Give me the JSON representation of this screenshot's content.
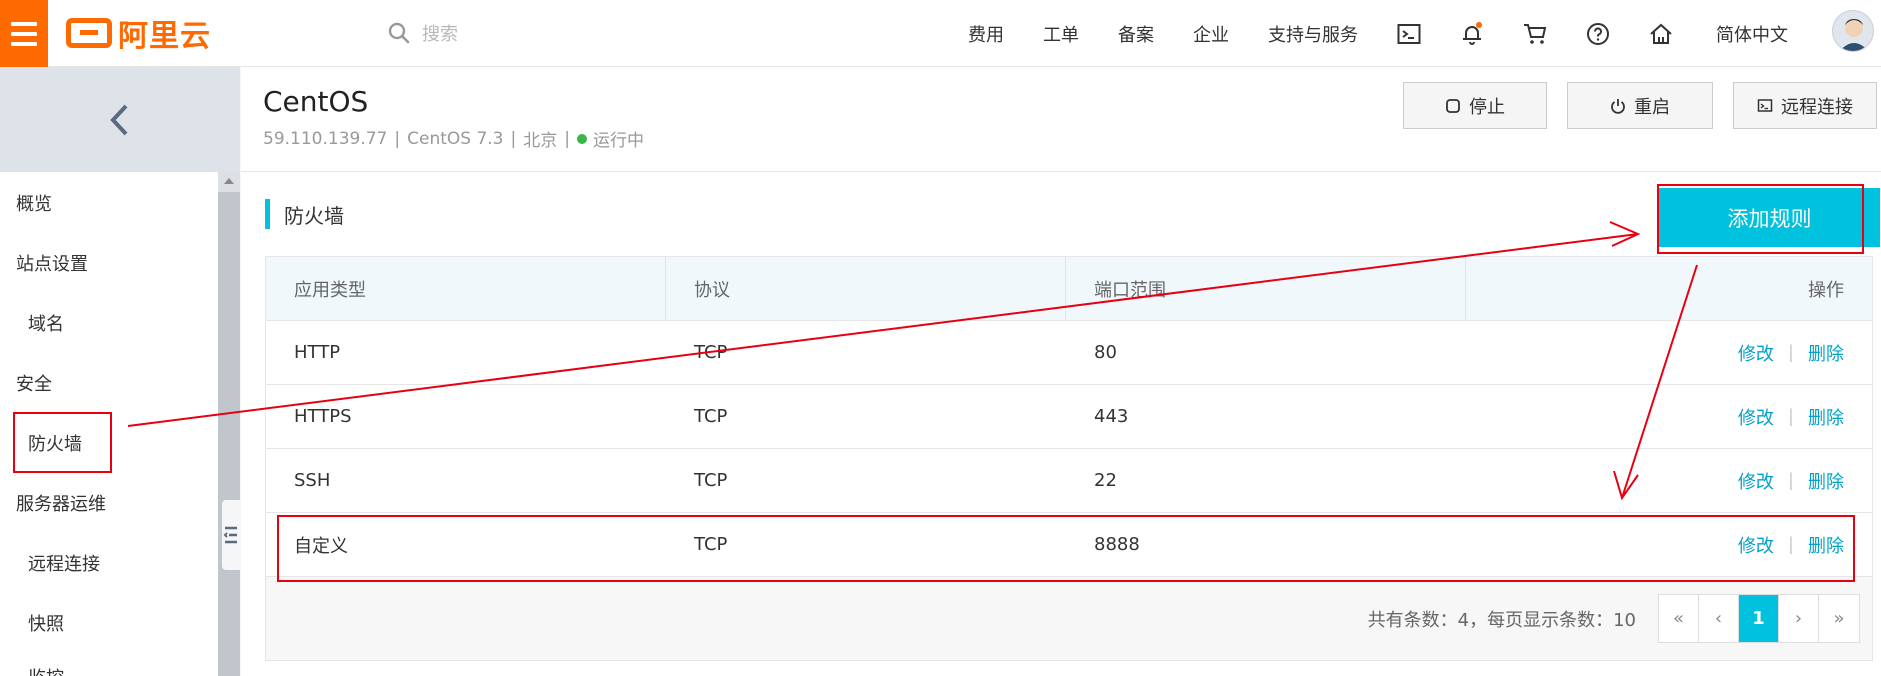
{
  "topbar": {
    "logo_text": "阿里云",
    "search_placeholder": "搜索",
    "nav": [
      "费用",
      "工单",
      "备案",
      "企业",
      "支持与服务"
    ],
    "icons": [
      "terminal-icon",
      "bell-icon",
      "cart-icon",
      "help-icon",
      "home-icon"
    ],
    "language": "简体中文",
    "accent": "#ff6a00"
  },
  "sidebar": {
    "items": [
      {
        "label": "概览",
        "sub": false
      },
      {
        "label": "站点设置",
        "sub": false
      },
      {
        "label": "域名",
        "sub": true
      },
      {
        "label": "安全",
        "sub": false
      },
      {
        "label": "防火墙",
        "sub": true
      },
      {
        "label": "服务器运维",
        "sub": false
      },
      {
        "label": "远程连接",
        "sub": true
      },
      {
        "label": "快照",
        "sub": true
      },
      {
        "label": "监控",
        "sub": true
      }
    ]
  },
  "server": {
    "title": "CentOS",
    "ip": "59.110.139.77",
    "os": "CentOS 7.3",
    "region": "北京",
    "status": "运行中",
    "status_color": "#39b54a",
    "separator": "|"
  },
  "actions": {
    "stop": "停止",
    "restart": "重启",
    "remote": "远程连接"
  },
  "firewall": {
    "title": "防火墙",
    "add_label": "添加规则",
    "columns": [
      "应用类型",
      "协议",
      "端口范围",
      "操作"
    ],
    "rows": [
      {
        "type": "HTTP",
        "protocol": "TCP",
        "port": "80"
      },
      {
        "type": "HTTPS",
        "protocol": "TCP",
        "port": "443"
      },
      {
        "type": "SSH",
        "protocol": "TCP",
        "port": "22"
      },
      {
        "type": "自定义",
        "protocol": "TCP",
        "port": "8888"
      }
    ],
    "edit_label": "修改",
    "delete_label": "删除",
    "op_separator": "|",
    "summary": "共有条数：4，每页显示条数：10",
    "pager": [
      "«",
      "‹",
      "1",
      "›",
      "»"
    ],
    "current_page": "1",
    "brand_color": "#00c1de"
  }
}
